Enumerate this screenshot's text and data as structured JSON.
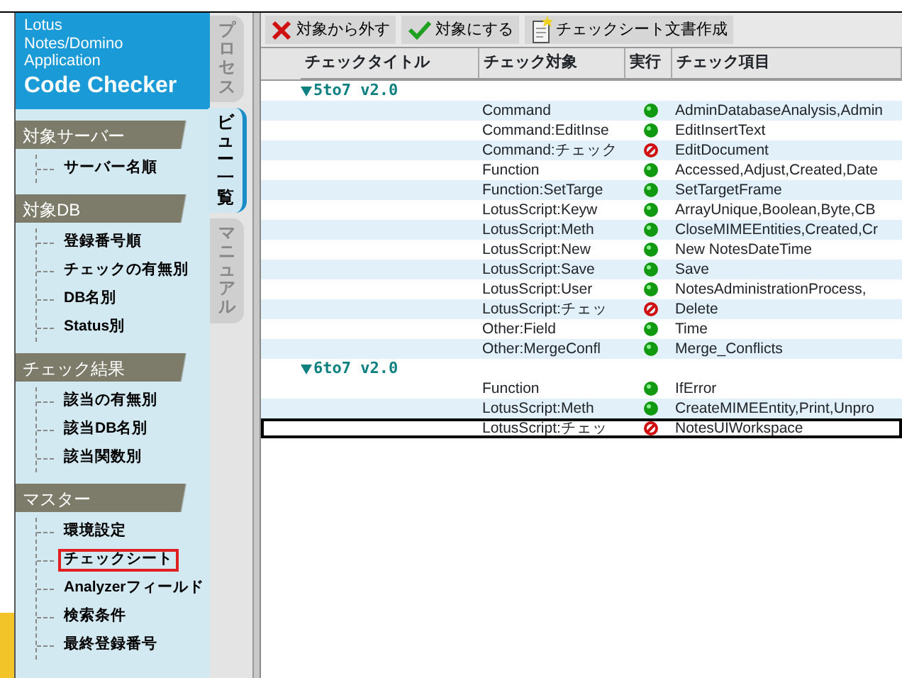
{
  "logo": {
    "lines": [
      "Lotus",
      "Notes/Domino",
      "Application"
    ],
    "title": "Code Checker"
  },
  "side_tabs": [
    {
      "label": "プロセス",
      "selected": false
    },
    {
      "label": "ビュー一覧",
      "selected": true
    },
    {
      "label": "マニュアル",
      "selected": false
    }
  ],
  "sidebar": [
    {
      "heading": "対象サーバー",
      "items": [
        {
          "label": "サーバー名順",
          "selected": false
        }
      ]
    },
    {
      "heading": "対象DB",
      "items": [
        {
          "label": "登録番号順",
          "selected": false
        },
        {
          "label": "チェックの有無別",
          "selected": false
        },
        {
          "label": "DB名別",
          "selected": false
        },
        {
          "label": "Status別",
          "selected": false
        }
      ]
    },
    {
      "heading": "チェック結果",
      "items": [
        {
          "label": "該当の有無別",
          "selected": false
        },
        {
          "label": "該当DB名別",
          "selected": false
        },
        {
          "label": "該当関数別",
          "selected": false
        }
      ]
    },
    {
      "heading": "マスター",
      "items": [
        {
          "label": "環境設定",
          "selected": false
        },
        {
          "label": "チェックシート",
          "selected": true
        },
        {
          "label": "Analyzerフィールド",
          "selected": false
        },
        {
          "label": "検索条件",
          "selected": false
        },
        {
          "label": "最終登録番号",
          "selected": false
        }
      ]
    }
  ],
  "toolbar": [
    {
      "kind": "exclude",
      "label": "対象から外す"
    },
    {
      "kind": "include",
      "label": "対象にする"
    },
    {
      "kind": "create",
      "label": "チェックシート文書作成"
    }
  ],
  "table": {
    "columns": [
      "チェックタイトル",
      "チェック対象",
      "実行",
      "チェック項目"
    ],
    "groups": [
      {
        "title": "5to7 v2.0",
        "expanded": true,
        "rows": [
          {
            "target": "Command",
            "enabled": true,
            "items": "AdminDatabaseAnalysis,Admin",
            "selected": false
          },
          {
            "target": "Command:EditInse",
            "enabled": true,
            "items": "EditInsertText",
            "selected": false
          },
          {
            "target": "Command:チェック",
            "enabled": false,
            "items": "EditDocument",
            "selected": false
          },
          {
            "target": "Function",
            "enabled": true,
            "items": "Accessed,Adjust,Created,Date",
            "selected": false
          },
          {
            "target": "Function:SetTarge",
            "enabled": true,
            "items": "SetTargetFrame",
            "selected": false
          },
          {
            "target": "LotusScript:Keyw",
            "enabled": true,
            "items": "ArrayUnique,Boolean,Byte,CB",
            "selected": false
          },
          {
            "target": "LotusScript:Meth",
            "enabled": true,
            "items": "CloseMIMEEntities,Created,Cr",
            "selected": false
          },
          {
            "target": "LotusScript:New",
            "enabled": true,
            "items": "New NotesDateTime",
            "selected": false
          },
          {
            "target": "LotusScript:Save",
            "enabled": true,
            "items": "Save",
            "selected": false
          },
          {
            "target": "LotusScript:User",
            "enabled": true,
            "items": "NotesAdministrationProcess,",
            "selected": false
          },
          {
            "target": "LotusScript:チェッ",
            "enabled": false,
            "items": "Delete",
            "selected": false
          },
          {
            "target": "Other:Field",
            "enabled": true,
            "items": "Time",
            "selected": false
          },
          {
            "target": "Other:MergeConfl",
            "enabled": true,
            "items": "Merge_Conflicts",
            "selected": false
          }
        ]
      },
      {
        "title": "6to7 v2.0",
        "expanded": true,
        "rows": [
          {
            "target": "Function",
            "enabled": true,
            "items": "IfError",
            "selected": false
          },
          {
            "target": "LotusScript:Meth",
            "enabled": true,
            "items": "CreateMIMEEntity,Print,Unpro",
            "selected": false
          },
          {
            "target": "LotusScript:チェッ",
            "enabled": false,
            "items": "NotesUIWorkspace",
            "selected": true
          }
        ]
      }
    ]
  }
}
